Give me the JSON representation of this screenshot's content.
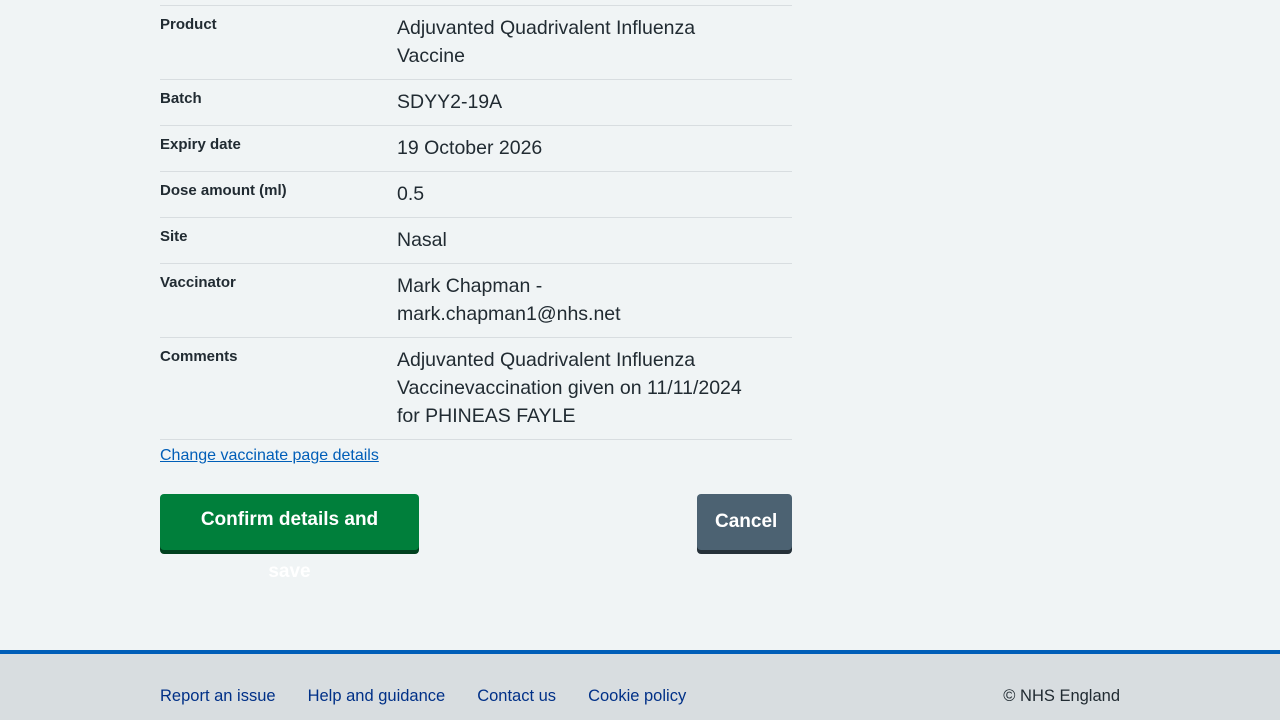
{
  "summary": {
    "rows": [
      {
        "key": "Product",
        "value": "Adjuvanted Quadrivalent Influenza Vaccine"
      },
      {
        "key": "Batch",
        "value": "SDYY2-19A"
      },
      {
        "key": "Expiry date",
        "value": "19 October 2026"
      },
      {
        "key": "Dose amount (ml)",
        "value": "0.5"
      },
      {
        "key": "Site",
        "value": "Nasal"
      },
      {
        "key": "Vaccinator",
        "value": "Mark Chapman - mark.chapman1@nhs.net"
      },
      {
        "key": "Comments",
        "value": "Adjuvanted Quadrivalent Influenza Vaccinevaccination given on 11/11/2024 for PHINEAS FAYLE"
      }
    ]
  },
  "change_link": "Change vaccinate page details",
  "buttons": {
    "confirm_label": "Confirm details and save",
    "cancel_label": "Cancel"
  },
  "footer": {
    "links": [
      "Report an issue",
      "Help and guidance",
      "Contact us",
      "Cookie policy"
    ],
    "copyright": "© NHS England"
  },
  "colors": {
    "background": "#f0f4f5",
    "primary_button": "#007f3b",
    "secondary_button": "#4c6272",
    "link": "#005eb8",
    "footer_bar": "#005eb8",
    "footer_bg": "#d8dde0"
  }
}
